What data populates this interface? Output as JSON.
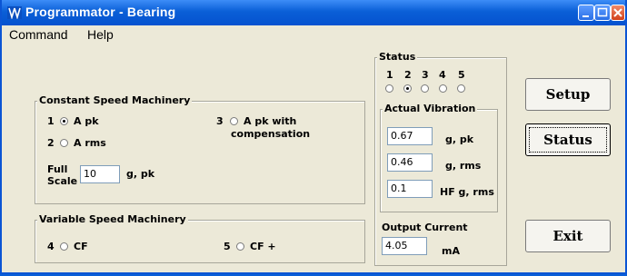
{
  "window": {
    "title": "Programmator - Bearing"
  },
  "menu": [
    "Command",
    "Help"
  ],
  "constant_speed": {
    "title": "Constant Speed Machinery",
    "options": [
      {
        "num": "1",
        "label": "A pk",
        "checked": true
      },
      {
        "num": "2",
        "label": "A rms",
        "checked": false
      },
      {
        "num": "3",
        "label_line1": "A pk with",
        "label_line2": "compensation",
        "checked": false
      }
    ],
    "full_scale": {
      "label_line1": "Full",
      "label_line2": "Scale",
      "value": "10",
      "unit": "g, pk"
    }
  },
  "variable_speed": {
    "title": "Variable Speed Machinery",
    "options": [
      {
        "num": "4",
        "label": "CF",
        "checked": false
      },
      {
        "num": "5",
        "label": "CF +",
        "checked": false
      }
    ]
  },
  "status": {
    "title": "Status",
    "numbers": [
      "1",
      "2",
      "3",
      "4",
      "5"
    ],
    "selected": "2"
  },
  "actual_vibration": {
    "title": "Actual Vibration",
    "rows": [
      {
        "value": "0.67",
        "unit": "g, pk"
      },
      {
        "value": "0.46",
        "unit": "g, rms"
      },
      {
        "value": "0.1",
        "unit": "HF g, rms"
      }
    ]
  },
  "output_current": {
    "title": "Output Current",
    "value": "4.05",
    "unit": "mA"
  },
  "buttons": {
    "setup": "Setup",
    "status": "Status",
    "exit": "Exit"
  },
  "colors": {
    "titlebar": "#0a5fd7",
    "window_bg": "#ece9d8",
    "groupbox_border": "#a7a69a"
  }
}
